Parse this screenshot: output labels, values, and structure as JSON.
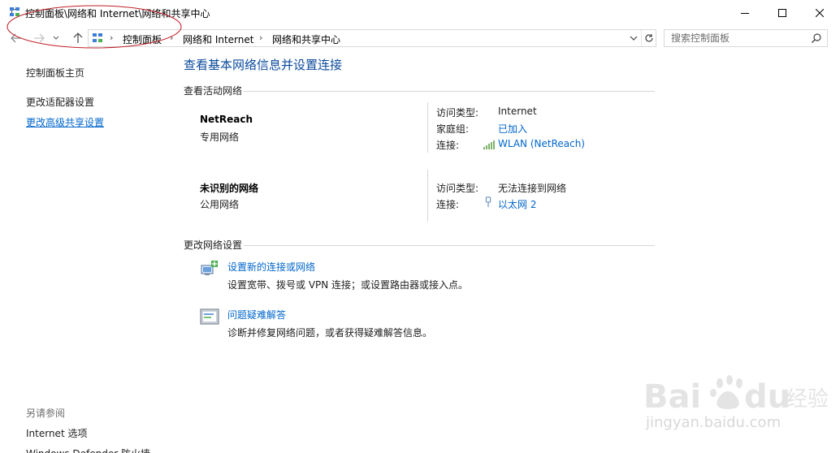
{
  "window": {
    "title": "控制面板\\网络和 Internet\\网络和共享中心"
  },
  "nav": {
    "breadcrumbs": [
      "控制面板",
      "网络和 Internet",
      "网络和共享中心"
    ],
    "search_placeholder": "搜索控制面板"
  },
  "sidebar": {
    "home": "控制面板主页",
    "items": [
      {
        "label": "更改适配器设置"
      },
      {
        "label": "更改高级共享设置"
      }
    ],
    "see_also_title": "另请参阅",
    "see_also": [
      {
        "label": "Internet 选项"
      },
      {
        "label": "Windows Defender 防火墙"
      }
    ]
  },
  "main": {
    "title": "查看基本网络信息并设置连接",
    "active_section": "查看活动网络",
    "networks": [
      {
        "name": "NetReach",
        "type": "专用网络",
        "access_key": "访问类型:",
        "access_val": "Internet",
        "homegroup_key": "家庭组:",
        "homegroup_val": "已加入",
        "conn_key": "连接:",
        "conn_val": "WLAN (NetReach)",
        "conn_icon": "wifi-signal-icon"
      },
      {
        "name": "未识别的网络",
        "type": "公用网络",
        "access_key": "访问类型:",
        "access_val": "无法连接到网络",
        "conn_key": "连接:",
        "conn_val": "以太网 2",
        "conn_icon": "ethernet-icon"
      }
    ],
    "change_section": "更改网络设置",
    "tasks": [
      {
        "link": "设置新的连接或网络",
        "desc": "设置宽带、拨号或 VPN 连接；或设置路由器或接入点。",
        "icon": "new-connection-icon"
      },
      {
        "link": "问题疑难解答",
        "desc": "诊断并修复网络问题，或者获得疑难解答信息。",
        "icon": "troubleshoot-icon"
      }
    ]
  },
  "watermark": {
    "brand": "Bai du 经验",
    "url": "jingyan.baidu.com"
  },
  "colors": {
    "link": "#0066cc",
    "title": "#0a4a9c",
    "annotation": "#c0202a"
  }
}
